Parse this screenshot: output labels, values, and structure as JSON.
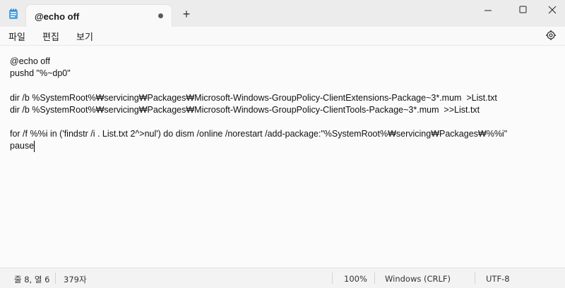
{
  "window": {
    "tab_title": "@echo off",
    "new_tab_label": "+"
  },
  "menu": {
    "file": "파일",
    "edit": "편집",
    "view": "보기"
  },
  "editor": {
    "lines": [
      "@echo off",
      "pushd \"%~dp0\"",
      "",
      "dir /b %SystemRoot%₩servicing₩Packages₩Microsoft-Windows-GroupPolicy-ClientExtensions-Package~3*.mum  >List.txt",
      "dir /b %SystemRoot%₩servicing₩Packages₩Microsoft-Windows-GroupPolicy-ClientTools-Package~3*.mum  >>List.txt",
      "",
      "for /f %%i in ('findstr /i . List.txt 2^>nul') do dism /online /norestart /add-package:\"%SystemRoot%₩servicing₩Packages₩%%i\"",
      "pause"
    ]
  },
  "status": {
    "position": "줄 8, 열 6",
    "char_count": "379자",
    "zoom": "100%",
    "line_ending": "Windows (CRLF)",
    "encoding": "UTF-8"
  },
  "icons": {
    "app": "notepad-icon",
    "settings": "gear-icon",
    "minimize": "minimize-icon",
    "maximize": "maximize-icon",
    "close": "close-icon"
  }
}
